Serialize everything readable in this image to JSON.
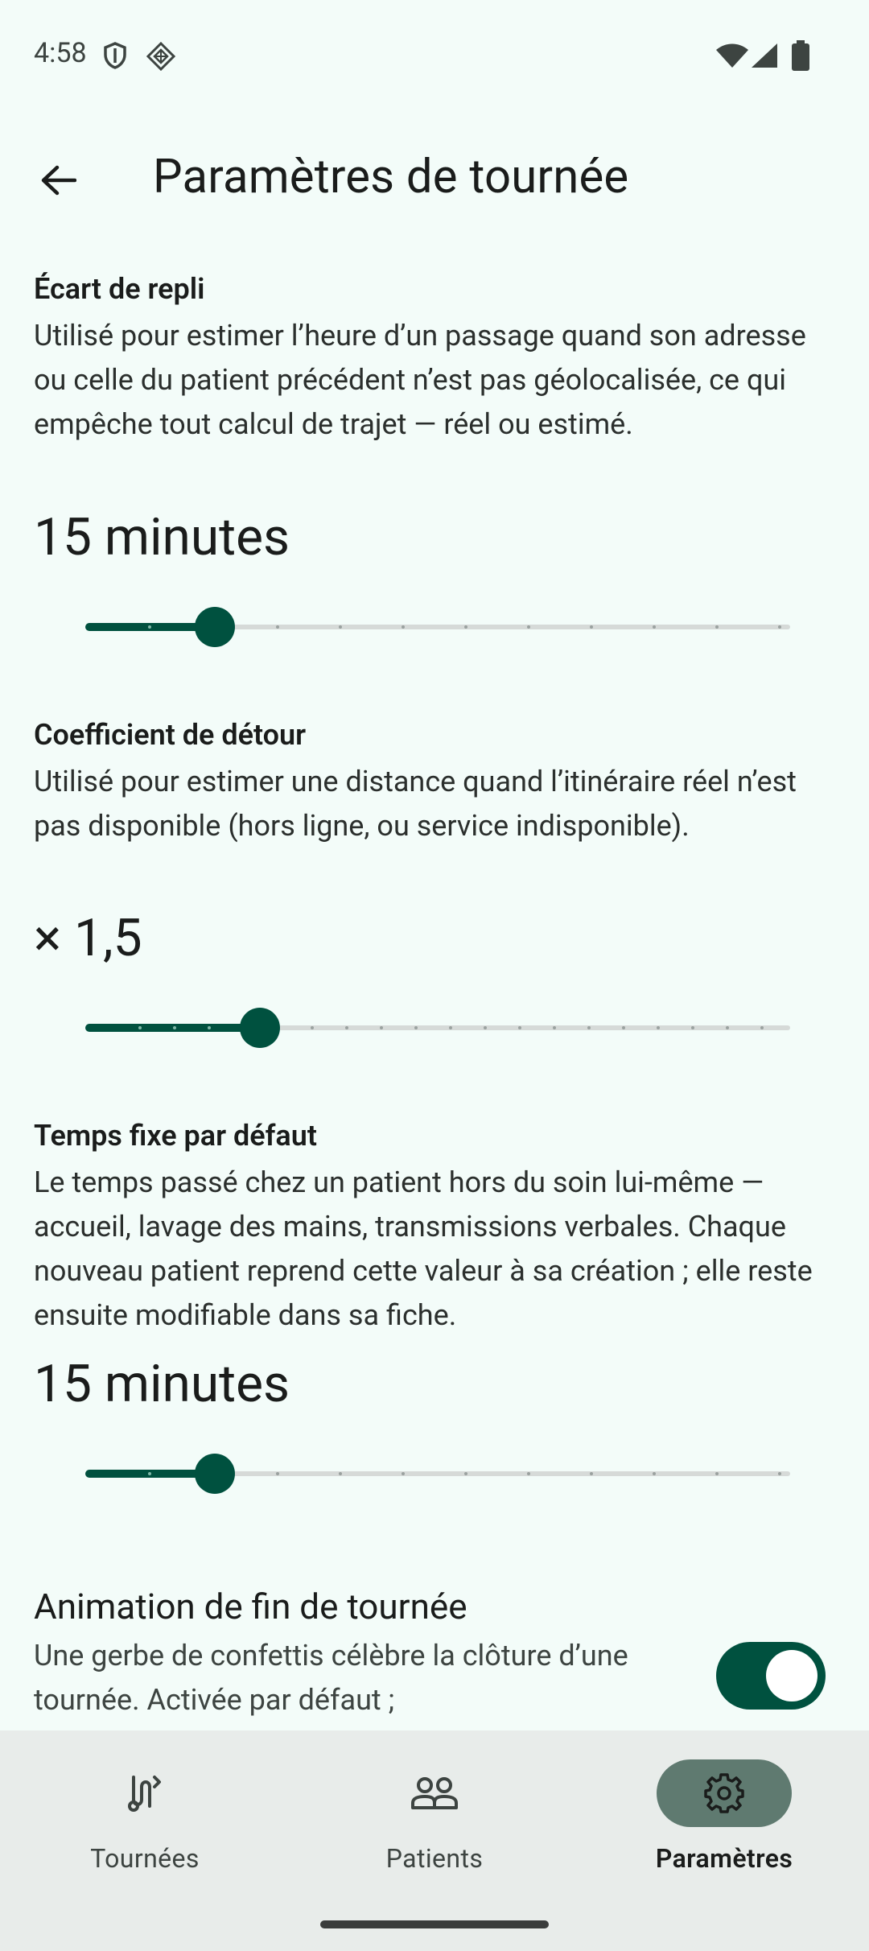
{
  "status_bar": {
    "time": "4:58"
  },
  "header": {
    "title": "Paramètres de tournée"
  },
  "sections": [
    {
      "title": "Écart de repli",
      "description": "Utilisé pour estimer l’heure d’un passage quand son adresse ou celle du patient précédent n’est pas géolocalisée, ce qui empêche tout calcul de trajet — réel ou estimé.",
      "value": "15 minutes"
    },
    {
      "title": "Coefficient de détour",
      "description": "Utilisé pour estimer une distance quand l’itinéraire réel n’est pas disponible (hors ligne, ou service indisponible).",
      "value": "× 1,5"
    },
    {
      "title": "Temps fixe par défaut",
      "description": "Le temps passé chez un patient hors du soin lui-même — accueil, lavage des mains, transmissions verbales. Chaque nouveau patient reprend cette valeur à sa création ; elle reste ensuite modifiable dans sa fiche.",
      "value": "15 minutes"
    }
  ],
  "toggle": {
    "title": "Animation de fin de tournée",
    "description": "Une gerbe de confettis célèbre la clôture d’une tournée. Activée par défaut ;",
    "enabled": true
  },
  "bottom_nav": {
    "items": [
      {
        "label": "Tournées",
        "icon": "route-icon",
        "active": false
      },
      {
        "label": "Patients",
        "icon": "people-icon",
        "active": false
      },
      {
        "label": "Paramètres",
        "icon": "gear-icon",
        "active": true
      }
    ]
  },
  "colors": {
    "accent": "#00513f",
    "background": "#f3fcf9",
    "nav_background": "#e8ecea",
    "nav_active_pill": "#5f7a70"
  }
}
